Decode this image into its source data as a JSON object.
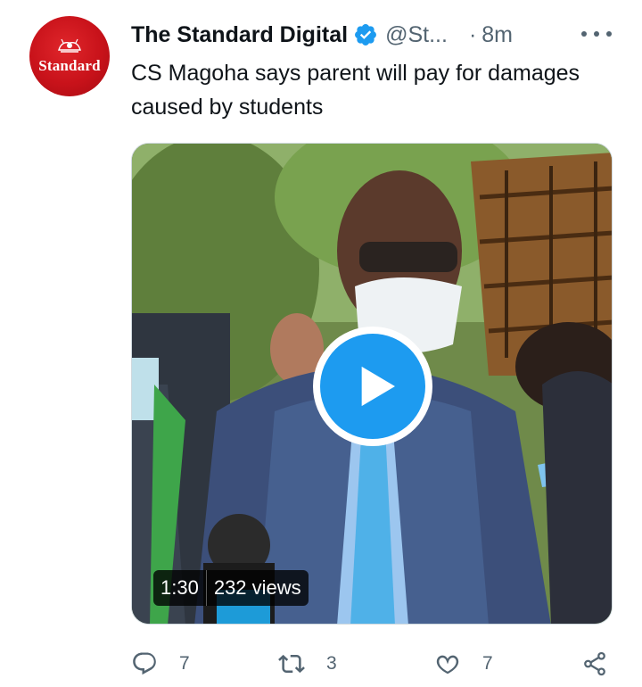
{
  "tweet": {
    "avatar_text": "Standard",
    "display_name": "The Standard Digital",
    "handle": "@St...",
    "separator": "·",
    "time": "8m",
    "text": "CS Magoha says parent will pay for damages caused by students",
    "media": {
      "duration": "1:30",
      "views": "232 views"
    },
    "actions": {
      "reply_count": "7",
      "retweet_count": "3",
      "like_count": "7"
    }
  },
  "colors": {
    "accent": "#1d9bf0",
    "text": "#0f1419",
    "secondary_text": "#536471",
    "avatar_red": "#c8121a"
  },
  "icons": [
    "verified-badge-icon",
    "more-icon",
    "play-icon",
    "reply-icon",
    "retweet-icon",
    "like-icon",
    "share-icon"
  ]
}
